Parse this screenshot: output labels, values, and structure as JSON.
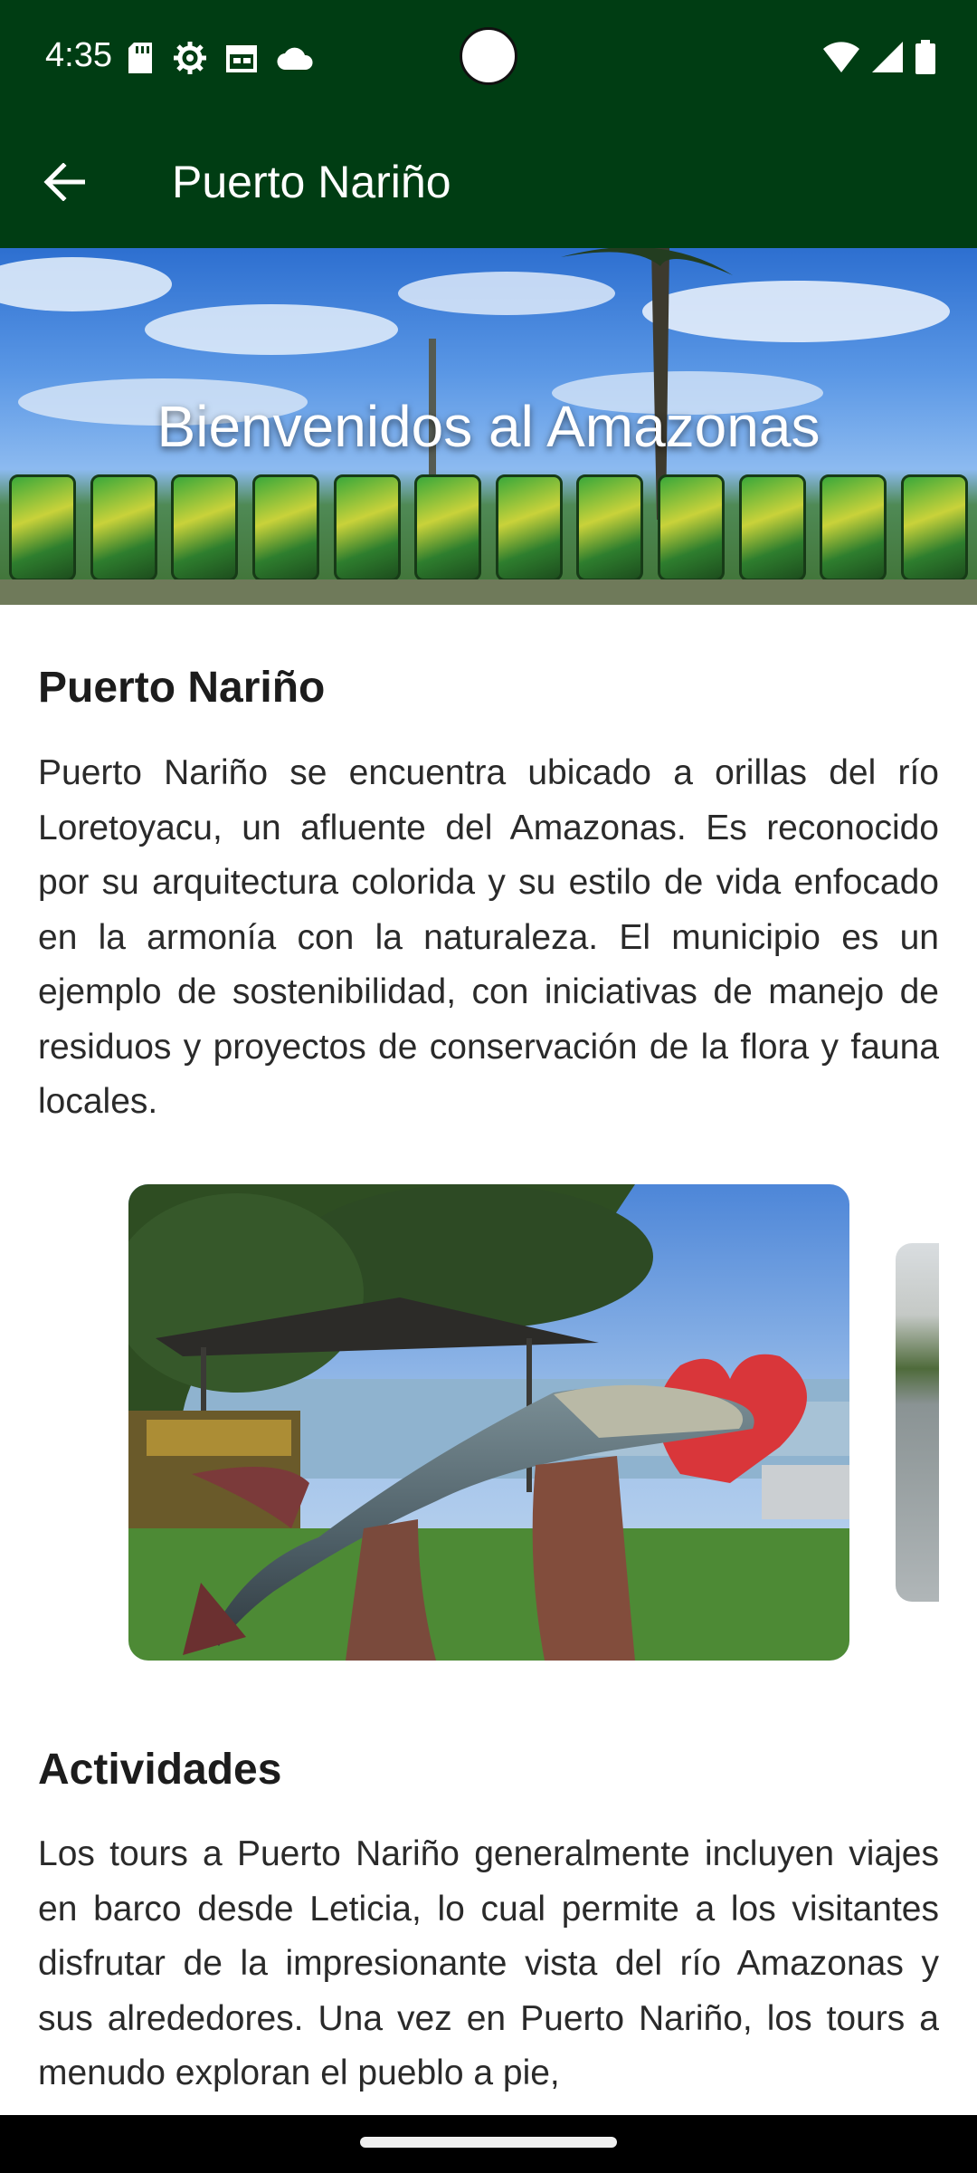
{
  "status_bar": {
    "time": "4:35",
    "left_icons": [
      "sd-card-icon",
      "settings-icon",
      "calendar-icon",
      "cloud-icon"
    ],
    "right_icons": [
      "wifi-icon",
      "signal-icon",
      "battery-icon"
    ]
  },
  "app_bar": {
    "title": "Puerto Nariño",
    "back_icon": "arrow-left-icon",
    "background_color": "#003d13"
  },
  "hero": {
    "title": "Bienvenidos al Amazonas"
  },
  "sections": [
    {
      "title": "Puerto Nariño",
      "body": "Puerto Nariño se encuentra ubicado a orillas del río Loretoyacu, un afluente del Amazonas. Es reconocido por su arquitectura colorida y su estilo de vida enfocado en la armonía con la naturaleza. El municipio es un ejemplo de sostenibilidad, con iniciativas de manejo de residuos y proyectos de conservación de la flora y fauna locales."
    },
    {
      "title": "Actividades",
      "body": "Los tours a Puerto Nariño generalmente incluyen viajes en barco desde Leticia, lo cual permite a los visitantes disfrutar de la impresionante vista del río Amazonas y sus alrededores. Una vez en Puerto Nariño, los tours a menudo exploran el pueblo a pie,"
    }
  ]
}
